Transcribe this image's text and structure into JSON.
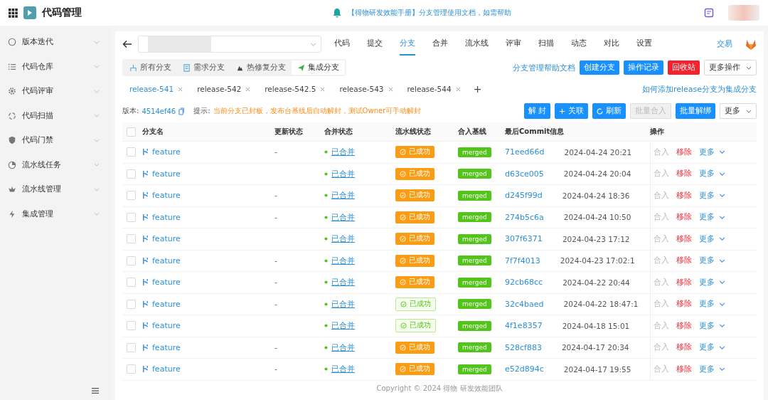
{
  "app": {
    "title": "代码管理",
    "notice": "【得物研发效能手册】分支管理使用文档，如需帮助"
  },
  "sidebar": {
    "items": [
      {
        "label": "版本迭代"
      },
      {
        "label": "代码仓库"
      },
      {
        "label": "代码评审"
      },
      {
        "label": "代码扫描"
      },
      {
        "label": "代码门禁"
      },
      {
        "label": "流水线任务"
      },
      {
        "label": "流水线管理"
      },
      {
        "label": "集成管理"
      }
    ]
  },
  "nav_tabs": [
    {
      "label": "代码",
      "selected": false
    },
    {
      "label": "提交",
      "selected": false
    },
    {
      "label": "分支",
      "selected": true
    },
    {
      "label": "合并",
      "selected": false
    },
    {
      "label": "流水线",
      "selected": false
    },
    {
      "label": "评审",
      "selected": false
    },
    {
      "label": "扫描",
      "selected": false
    },
    {
      "label": "动态",
      "selected": false
    },
    {
      "label": "对比",
      "selected": false
    },
    {
      "label": "设置",
      "selected": false
    }
  ],
  "nav_link": "交易",
  "branch_types": [
    {
      "label": "所有分支",
      "selected": false
    },
    {
      "label": "需求分支",
      "selected": false
    },
    {
      "label": "热修复分支",
      "selected": false
    },
    {
      "label": "集成分支",
      "selected": true
    }
  ],
  "branch_actions": [
    {
      "label": "分支管理帮助文档",
      "kind": "link"
    },
    {
      "label": "创建分支",
      "kind": "primary"
    },
    {
      "label": "操作记录",
      "kind": "primary"
    },
    {
      "label": "回收站",
      "kind": "danger"
    },
    {
      "label": "更多操作",
      "kind": "dropdown"
    }
  ],
  "release_tabs": [
    {
      "label": "release-541",
      "selected": true
    },
    {
      "label": "release-542",
      "selected": false
    },
    {
      "label": "release-542.5",
      "selected": false
    },
    {
      "label": "release-543",
      "selected": false
    },
    {
      "label": "release-544",
      "selected": false
    }
  ],
  "release_add": "+",
  "release_help": "如何添加release分支为集成分支",
  "info": {
    "version_label": "版本:",
    "version": "4514ef46",
    "hint_label": "提示:",
    "hint": "当前分支已封板，发布台基线后自动解封，测试Owner可手动解封"
  },
  "toolbar": [
    {
      "label": "解 封",
      "kind": "primary",
      "disabled": false
    },
    {
      "label": "关联",
      "kind": "add",
      "disabled": false
    },
    {
      "label": "刷新",
      "kind": "refresh",
      "disabled": false
    },
    {
      "label": "批量合入",
      "kind": "primary",
      "disabled": true
    },
    {
      "label": "批量解绑",
      "kind": "primary",
      "disabled": false
    },
    {
      "label": "更多",
      "kind": "dropdown",
      "disabled": false
    }
  ],
  "table": {
    "select_all_checked": false,
    "columns": [
      "分支名",
      "更新状态",
      "合并状态",
      "流水线状态",
      "合入基线",
      "最后Commit信息",
      "操作"
    ],
    "rows": [
      {
        "checked": false,
        "branch": "feature",
        "update": "-",
        "merge": "已合并",
        "pipeline": "已成功",
        "pipeline_outlined": false,
        "baseline": "merged",
        "commit": "71eed66d",
        "date": "2024-04-24 20:21",
        "actions": [
          {
            "label": "合入",
            "kind": "muted"
          },
          {
            "label": "移除",
            "kind": "danger"
          },
          {
            "label": "更多",
            "kind": "more"
          }
        ]
      },
      {
        "checked": false,
        "branch": "feature",
        "merge": "已合并",
        "pipeline": "已成功",
        "pipeline_outlined": false,
        "baseline": "merged",
        "commit": "d63ce005",
        "date": "2024-04-24 20:04",
        "actions": [
          {
            "label": "合入",
            "kind": "muted"
          },
          {
            "label": "移除",
            "kind": "danger"
          },
          {
            "label": "更多",
            "kind": "more"
          }
        ]
      },
      {
        "checked": false,
        "branch": "feature",
        "update": "-",
        "merge": "已合并",
        "pipeline": "已成功",
        "pipeline_outlined": false,
        "baseline": "merged",
        "commit": "d245f99d",
        "date": "2024-04-24 18:36",
        "actions": [
          {
            "label": "合入",
            "kind": "muted"
          },
          {
            "label": "移除",
            "kind": "danger"
          },
          {
            "label": "更多",
            "kind": "more"
          }
        ]
      },
      {
        "checked": false,
        "branch": "feature",
        "update": "-",
        "merge": "已合并",
        "pipeline": "已成功",
        "pipeline_outlined": false,
        "baseline": "merged",
        "commit": "274b5c6a",
        "date": "2024-04-24 10:50",
        "actions": [
          {
            "label": "合入",
            "kind": "muted"
          },
          {
            "label": "移除",
            "kind": "danger"
          },
          {
            "label": "更多",
            "kind": "more"
          }
        ]
      },
      {
        "checked": false,
        "branch": "feature",
        "merge": "已合并",
        "pipeline": "已成功",
        "pipeline_outlined": false,
        "baseline": "merged",
        "commit": "307f6371",
        "date": "2024-04-23 17:12",
        "actions": [
          {
            "label": "合入",
            "kind": "muted"
          },
          {
            "label": "移除",
            "kind": "danger"
          },
          {
            "label": "更多",
            "kind": "more"
          }
        ]
      },
      {
        "checked": false,
        "branch": "feature",
        "update": "-",
        "merge": "已合并",
        "pipeline": "已成功",
        "pipeline_outlined": false,
        "baseline": "merged",
        "commit": "7f7f4013",
        "date": "2024-04-23 17:02:1",
        "actions": [
          {
            "label": "合入",
            "kind": "muted"
          },
          {
            "label": "移除",
            "kind": "danger"
          },
          {
            "label": "更多",
            "kind": "more"
          }
        ]
      },
      {
        "checked": false,
        "branch": "feature",
        "update": "-",
        "merge": "已合并",
        "pipeline": "已成功",
        "pipeline_outlined": false,
        "baseline": "merged",
        "commit": "92cb68cc",
        "date": "2024-04-22 20:44",
        "actions": [
          {
            "label": "合入",
            "kind": "muted"
          },
          {
            "label": "移除",
            "kind": "danger"
          },
          {
            "label": "更多",
            "kind": "more"
          }
        ]
      },
      {
        "checked": false,
        "branch": "feature",
        "update": "-",
        "merge": "已合并",
        "pipeline": "已成功",
        "pipeline_outlined": true,
        "baseline": "merged",
        "commit": "32c4baed",
        "date": "2024-04-22 18:47:1",
        "actions": [
          {
            "label": "合入",
            "kind": "muted"
          },
          {
            "label": "移除",
            "kind": "danger"
          },
          {
            "label": "更多",
            "kind": "more"
          }
        ]
      },
      {
        "checked": false,
        "branch": "feature",
        "merge": "已合并",
        "pipeline": "已成功",
        "pipeline_outlined": true,
        "baseline": "merged",
        "commit": "4f1e8357",
        "date": "2024-04-18 15:01",
        "actions": [
          {
            "label": "合入",
            "kind": "muted"
          },
          {
            "label": "移除",
            "kind": "danger"
          },
          {
            "label": "更多",
            "kind": "more"
          }
        ]
      },
      {
        "checked": false,
        "branch": "feature",
        "update": "-",
        "merge": "已合并",
        "pipeline": "已成功",
        "pipeline_outlined": false,
        "baseline": "merged",
        "commit": "528cf883",
        "date": "2024-04-17 20:34",
        "actions": [
          {
            "label": "合入",
            "kind": "muted"
          },
          {
            "label": "移除",
            "kind": "danger"
          },
          {
            "label": "更多",
            "kind": "more"
          }
        ]
      },
      {
        "checked": false,
        "branch": "feature",
        "update": "-",
        "merge": "已合并",
        "pipeline": "已成功",
        "pipeline_outlined": false,
        "baseline": "merged",
        "commit": "e52d894c",
        "date": "2024-04-17 19:55",
        "actions": [
          {
            "label": "合入",
            "kind": "muted"
          },
          {
            "label": "移除",
            "kind": "danger"
          },
          {
            "label": "更多",
            "kind": "more"
          }
        ]
      }
    ]
  },
  "footer": "Copyright © 2024 得物 研发效能团队"
}
